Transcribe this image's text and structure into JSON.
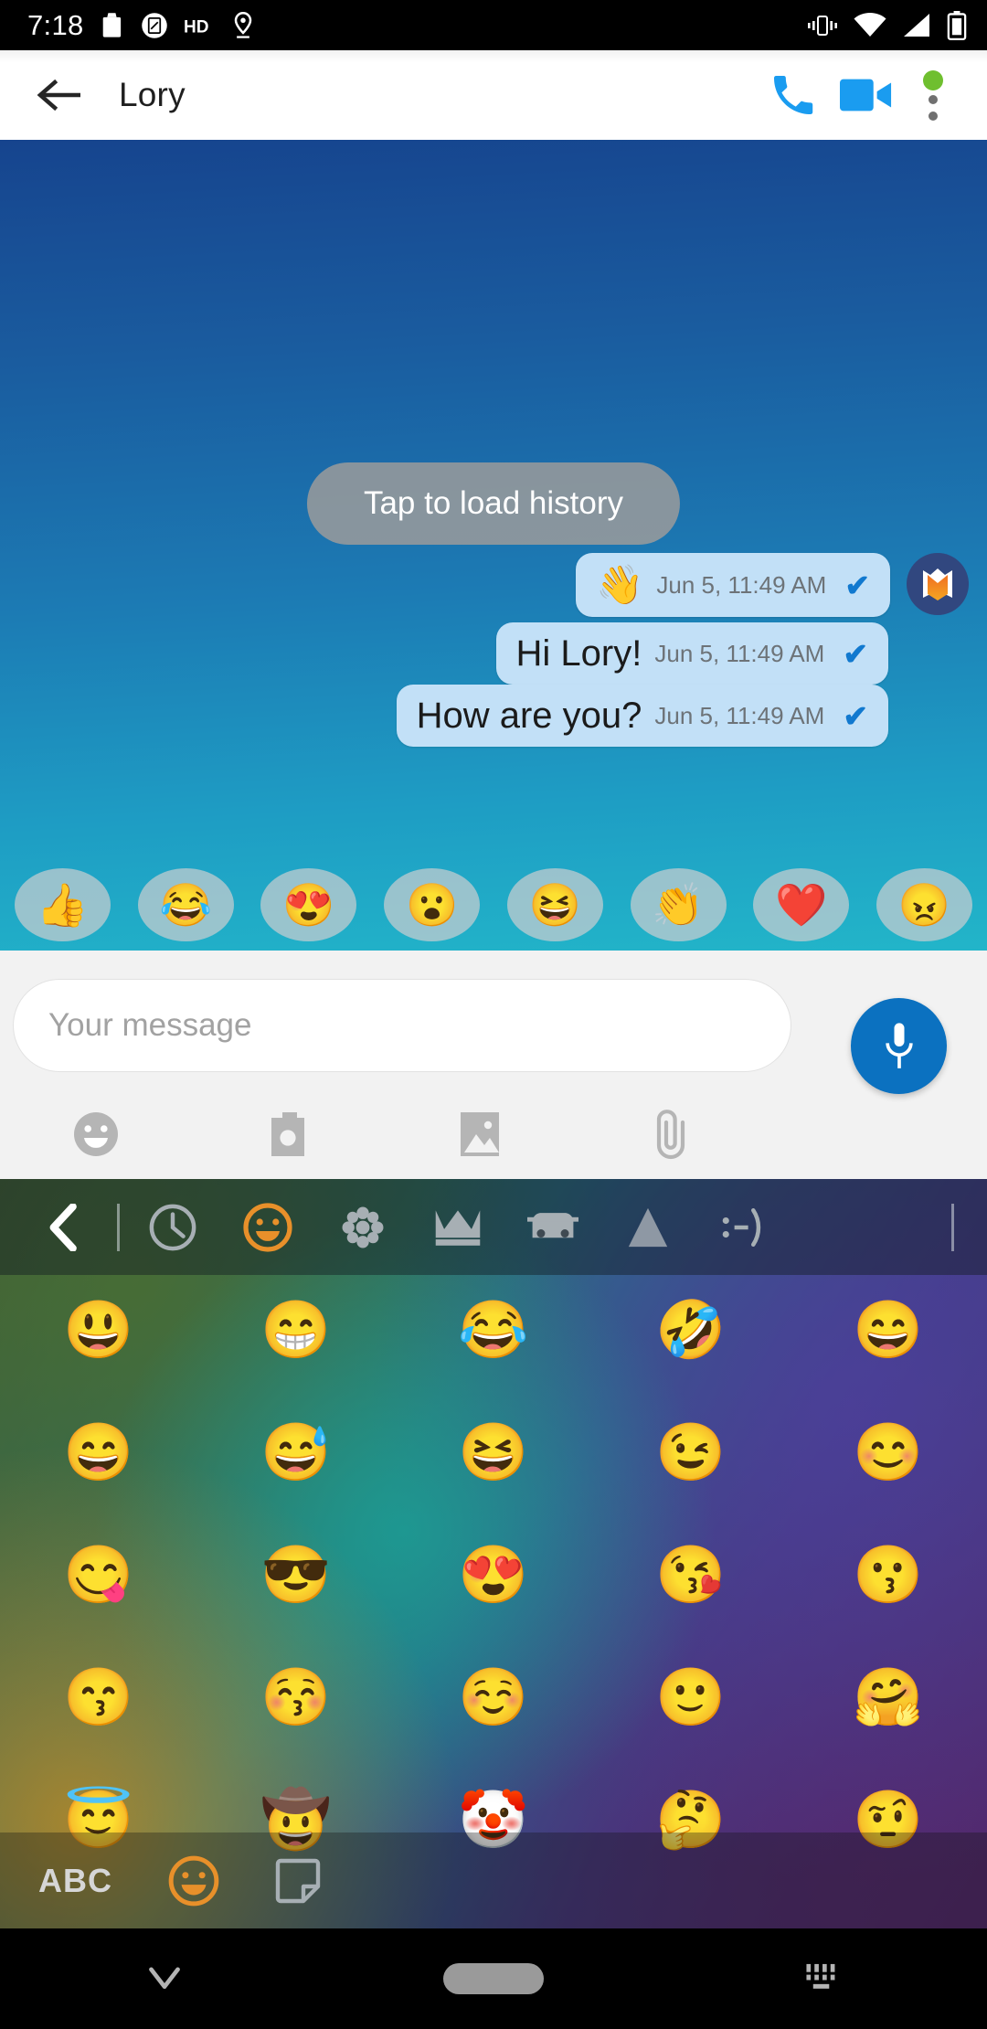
{
  "status_bar": {
    "time": "7:18",
    "left_icons": [
      "briefcase-icon",
      "screenshot-icon",
      "hd-icon",
      "location-icon"
    ],
    "right_icons": [
      "vibrate-icon",
      "wifi-icon",
      "signal-icon",
      "battery-icon"
    ]
  },
  "app_bar": {
    "back_label": "back-arrow",
    "title": "Lory",
    "call_label": "call",
    "video_label": "video-call",
    "overflow_label": "more-options",
    "badge_color": "#6fbf2f",
    "accent_color": "#1a9cf0"
  },
  "chat": {
    "load_history_label": "Tap to load history",
    "background_from": "#16448e",
    "background_to": "#22b5c9",
    "bubble_color": "#c2e0f7",
    "tick_color": "#1179cf",
    "tick_glyph": "✔",
    "messages": [
      {
        "emoji": "👋",
        "text": "",
        "time": "Jun 5, 11:49 AM",
        "status": "delivered",
        "avatar": true
      },
      {
        "emoji": "",
        "text": "Hi Lory!",
        "time": "Jun 5, 11:49 AM",
        "status": "delivered",
        "avatar": false
      },
      {
        "emoji": "",
        "text": "How are you?",
        "time": "Jun 5, 11:49 AM",
        "status": "delivered",
        "avatar": false
      }
    ],
    "reactions": [
      {
        "name": "thumbs-up",
        "glyph": "👍"
      },
      {
        "name": "joy",
        "glyph": "😂"
      },
      {
        "name": "heart-eyes",
        "glyph": "😍"
      },
      {
        "name": "open-mouth",
        "glyph": "😮"
      },
      {
        "name": "laughing",
        "glyph": "😆"
      },
      {
        "name": "clap",
        "glyph": "👏"
      },
      {
        "name": "red-heart",
        "glyph": "❤️"
      },
      {
        "name": "angry",
        "glyph": "😠"
      }
    ]
  },
  "composer": {
    "placeholder": "Your message",
    "value": "",
    "mic_label": "voice-message",
    "mic_color": "#0b71c0",
    "attachments": [
      {
        "name": "emoji-icon",
        "label": "emoji"
      },
      {
        "name": "camera-icon",
        "label": "camera"
      },
      {
        "name": "gallery-icon",
        "label": "gallery"
      },
      {
        "name": "paperclip-icon",
        "label": "attach file"
      }
    ]
  },
  "keyboard": {
    "active_category": "smileys",
    "active_color": "#e8902a",
    "categories": [
      {
        "name": "back-chevron-icon",
        "label": "back"
      },
      {
        "name": "recent-clock-icon",
        "label": "recent"
      },
      {
        "name": "smileys-icon",
        "label": "smileys",
        "active": true
      },
      {
        "name": "nature-flower-icon",
        "label": "nature"
      },
      {
        "name": "objects-crown-icon",
        "label": "objects"
      },
      {
        "name": "travel-car-icon",
        "label": "travel"
      },
      {
        "name": "symbols-triangle-icon",
        "label": "symbols"
      },
      {
        "name": "emoticons-icon",
        "label": ":-)"
      }
    ],
    "emoji_grid": [
      "😃",
      "😁",
      "😂",
      "🤣",
      "😄",
      "😄",
      "😅",
      "😆",
      "😉",
      "😊",
      "😋",
      "😎",
      "😍",
      "😘",
      "😗",
      "😙",
      "😚",
      "☺️",
      "🙂",
      "🤗",
      "😇",
      "🤠",
      "🤡",
      "🤔",
      "🤨"
    ],
    "bottom_bar": {
      "abc_label": "ABC",
      "emoji_label": "emoji-keyboard",
      "sticker_label": "stickers"
    }
  },
  "nav_bar": {
    "back_label": "hide-keyboard",
    "home_label": "home",
    "keyboard_switch_label": "switch-keyboard"
  }
}
